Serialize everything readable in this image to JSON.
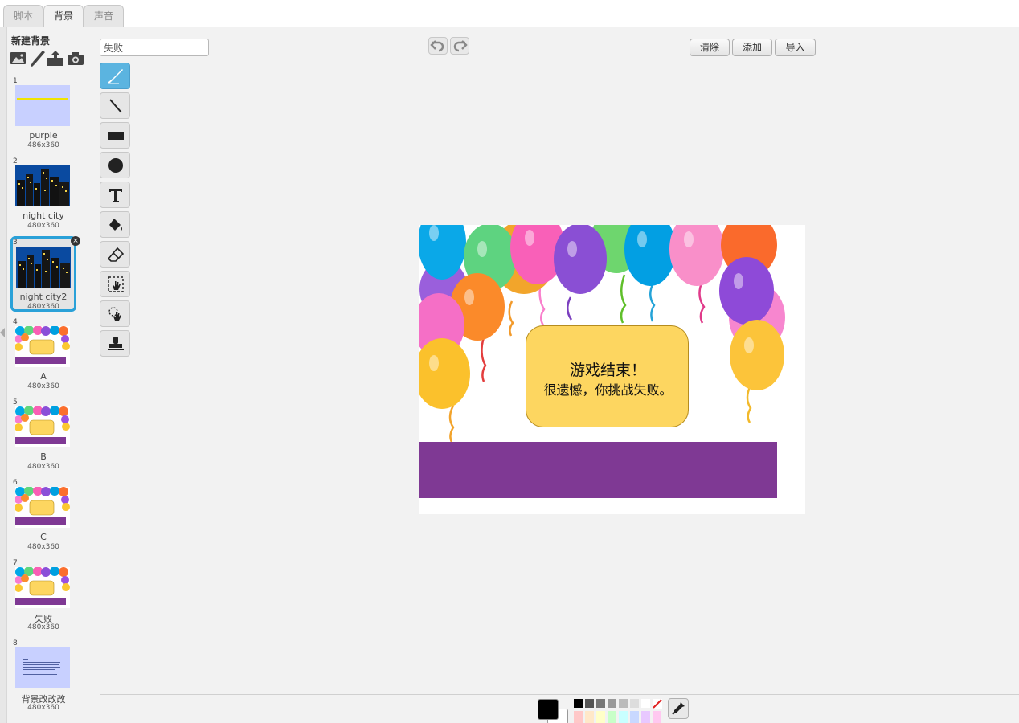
{
  "tabs": [
    {
      "label": "脚本"
    },
    {
      "label": "背景"
    },
    {
      "label": "声音"
    }
  ],
  "sidebar": {
    "new_backdrop_label": "新建背景",
    "new_icons": [
      "image-library-icon",
      "paint-brush-icon",
      "upload-icon",
      "camera-icon"
    ],
    "items": [
      {
        "num": "1",
        "name": "purple",
        "size": "486x360",
        "thumb": "purple-text"
      },
      {
        "num": "2",
        "name": "night city",
        "size": "480x360",
        "thumb": "city"
      },
      {
        "num": "3",
        "name": "night city2",
        "size": "480x360",
        "thumb": "city",
        "selected": true
      },
      {
        "num": "4",
        "name": "A",
        "size": "480x360",
        "thumb": "balloons"
      },
      {
        "num": "5",
        "name": "B",
        "size": "480x360",
        "thumb": "balloons"
      },
      {
        "num": "6",
        "name": "C",
        "size": "480x360",
        "thumb": "balloons"
      },
      {
        "num": "7",
        "name": "失败",
        "size": "480x360",
        "thumb": "balloons"
      },
      {
        "num": "8",
        "name": "背景改改改",
        "size": "480x360",
        "thumb": "text-list"
      }
    ]
  },
  "editor": {
    "costume_name_value": "失败",
    "buttons": {
      "clear": "清除",
      "add": "添加",
      "import": "导入"
    },
    "tools": [
      "brush-tool",
      "line-tool",
      "rectangle-tool",
      "ellipse-tool",
      "text-tool",
      "fill-tool",
      "eraser-tool",
      "select-tool",
      "select-clone-tool",
      "stamp-tool"
    ]
  },
  "canvas": {
    "message_line1": "游戏结束！",
    "message_line2": "很遗憾，你挑战失败。"
  },
  "colors": {
    "accent": "#2aa1d8",
    "banner": "#7f3994",
    "message_box": "#fdd660",
    "palette": [
      "#000000",
      "#555555",
      "#777777",
      "#999999",
      "#bbbbbb",
      "#dddddd",
      "#ffffff"
    ],
    "palette_row2": [
      "#ffc8c8",
      "#ffe8c8",
      "#ffffc8",
      "#c8ffc8",
      "#c8ffff",
      "#c8d8ff",
      "#e8c8ff",
      "#ffc8f0"
    ]
  }
}
